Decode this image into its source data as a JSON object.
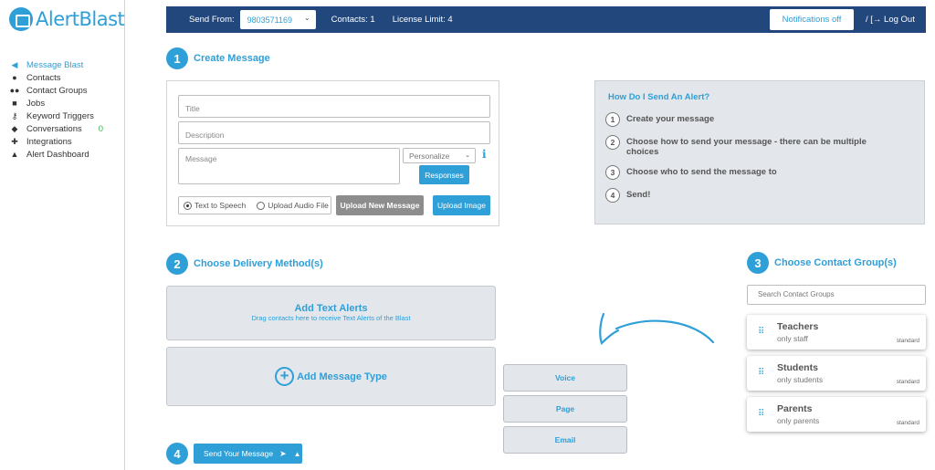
{
  "app": {
    "logo_text": "AlertBlast"
  },
  "sidebar": {
    "items": [
      {
        "label": "Message Blast",
        "icon": "megaphone-icon",
        "glyph": "📢",
        "active": true
      },
      {
        "label": "Contacts",
        "icon": "person-icon",
        "glyph": "👤"
      },
      {
        "label": "Contact Groups",
        "icon": "group-icon",
        "glyph": "👥"
      },
      {
        "label": "Jobs",
        "icon": "briefcase-icon",
        "glyph": "💼"
      },
      {
        "label": "Keyword Triggers",
        "icon": "key-icon",
        "glyph": "🔑"
      },
      {
        "label": "Conversations",
        "icon": "chat-icon",
        "glyph": "💬",
        "badge": "0"
      },
      {
        "label": "Integrations",
        "icon": "puzzle-icon",
        "glyph": "🧩"
      },
      {
        "label": "Alert Dashboard",
        "icon": "bell-icon",
        "glyph": "🔔"
      }
    ]
  },
  "topbar": {
    "send_from_label": "Send From:",
    "send_from_value": "9803571169",
    "contacts": "Contacts: 1",
    "license": "License Limit: 4",
    "notifications_button": "Notifications off",
    "logout": "/ [→ Log Out"
  },
  "steps": {
    "s1": {
      "num": "1",
      "title": "Create Message"
    },
    "s2": {
      "num": "2",
      "title": "Choose Delivery Method(s)"
    },
    "s3": {
      "num": "3",
      "title": "Choose Contact Group(s)"
    },
    "s4": {
      "num": "4"
    }
  },
  "create": {
    "title_placeholder": "Title",
    "description_placeholder": "Description",
    "message_placeholder": "Message",
    "personalize": "Personalize",
    "responses": "Responses",
    "text_to_speech": "Text to Speech",
    "upload_audio": "Upload Audio File",
    "upload_message": "Upload New Message",
    "upload_image": "Upload Image"
  },
  "howto": {
    "title": "How Do I Send An Alert?",
    "steps": [
      {
        "n": "1",
        "text": "Create your message"
      },
      {
        "n": "2",
        "text": "Choose how to send your message - there can be multiple choices"
      },
      {
        "n": "3",
        "text": "Choose who to send the message to"
      },
      {
        "n": "4",
        "text": "Send!"
      }
    ]
  },
  "delivery": {
    "text_alerts_title": "Add Text Alerts",
    "text_alerts_hint": "Drag contacts here to receive Text Alerts of the Blast",
    "add_message_type": "Add Message Type",
    "types": [
      "Voice",
      "Page",
      "Email"
    ]
  },
  "groups": {
    "search_placeholder": "Search Contact Groups",
    "items": [
      {
        "name": "Teachers",
        "desc": "only staff",
        "type": "standard"
      },
      {
        "name": "Students",
        "desc": "only students",
        "type": "standard"
      },
      {
        "name": "Parents",
        "desc": "only parents",
        "type": "standard"
      }
    ]
  },
  "send": {
    "label": "Send Your Message"
  },
  "colors": {
    "accent": "#2f9fd8",
    "navbar": "#22477d",
    "panel": "#e3e6ea"
  }
}
